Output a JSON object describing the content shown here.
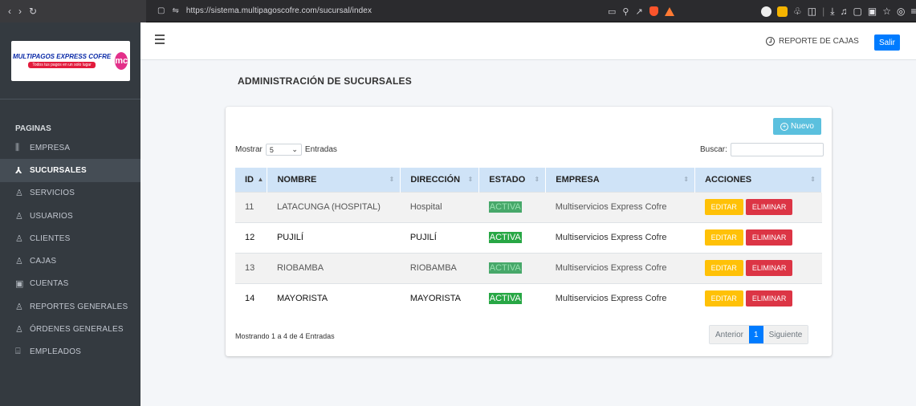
{
  "browser": {
    "url": "https://sistema.multipagoscofre.com/sucursal/index"
  },
  "sidebar": {
    "logo_main": "MULTIPAGOS EXPRESS COFRE",
    "logo_sub": "Todos tus pagos en un solo lugar",
    "logo_badge": "mc",
    "section_header": "PAGINAS",
    "items": [
      {
        "label": "EMPRESA",
        "icon": "sliders-icon",
        "glyph": "⫼",
        "active": false
      },
      {
        "label": "SUCURSALES",
        "icon": "sitemap-icon",
        "glyph": "⅄",
        "active": true
      },
      {
        "label": "SERVICIOS",
        "icon": "user-icon",
        "glyph": "♙",
        "active": false
      },
      {
        "label": "USUARIOS",
        "icon": "user-icon",
        "glyph": "♙",
        "active": false
      },
      {
        "label": "CLIENTES",
        "icon": "user-icon",
        "glyph": "♙",
        "active": false
      },
      {
        "label": "CAJAS",
        "icon": "user-icon",
        "glyph": "♙",
        "active": false
      },
      {
        "label": "CUENTAS",
        "icon": "ledger-icon",
        "glyph": "▣",
        "active": false
      },
      {
        "label": "REPORTES GENERALES",
        "icon": "user-icon",
        "glyph": "♙",
        "active": false
      },
      {
        "label": "ÓRDENES GENERALES",
        "icon": "user-icon",
        "glyph": "♙",
        "active": false
      },
      {
        "label": "EMPLEADOS",
        "icon": "id-card-icon",
        "glyph": "⌸",
        "active": false
      }
    ]
  },
  "navbar": {
    "report_label": "REPORTE DE CAJAS",
    "logout_label": "Salir"
  },
  "main": {
    "page_title": "ADMINISTRACIÓN DE SUCURSALES",
    "new_button": "Nuevo",
    "show_label": "Mostrar",
    "show_value": "5",
    "entries_label": "Entradas",
    "search_label": "Buscar:",
    "search_value": "",
    "columns": [
      "ID",
      "NOMBRE",
      "DIRECCIÓN",
      "ESTADO",
      "EMPRESA",
      "ACCIONES"
    ],
    "rows": [
      {
        "id": "11",
        "nombre": "LATACUNGA (HOSPITAL)",
        "direccion": "Hospital",
        "estado": "ACTIVA",
        "empresa": "Multiservicios Express Cofre"
      },
      {
        "id": "12",
        "nombre": "PUJILÍ",
        "direccion": "PUJILÍ",
        "estado": "ACTIVA",
        "empresa": "Multiservicios Express Cofre"
      },
      {
        "id": "13",
        "nombre": "RIOBAMBA",
        "direccion": "RIOBAMBA",
        "estado": "ACTIVA",
        "empresa": "Multiservicios Express Cofre"
      },
      {
        "id": "14",
        "nombre": "MAYORISTA",
        "direccion": "MAYORISTA",
        "estado": "ACTIVA",
        "empresa": "Multiservicios Express Cofre"
      }
    ],
    "edit_label": "EDITAR",
    "delete_label": "ELIMINAR",
    "footer_info": "Mostrando 1 a 4 de 4 Entradas",
    "pagination": {
      "prev": "Anterior",
      "current": "1",
      "next": "Siguiente"
    }
  },
  "colors": {
    "sidebar_bg": "#343a40",
    "primary": "#007bff",
    "info": "#5bc0de",
    "success": "#28a745",
    "warning": "#ffc107",
    "danger": "#dc3545"
  }
}
